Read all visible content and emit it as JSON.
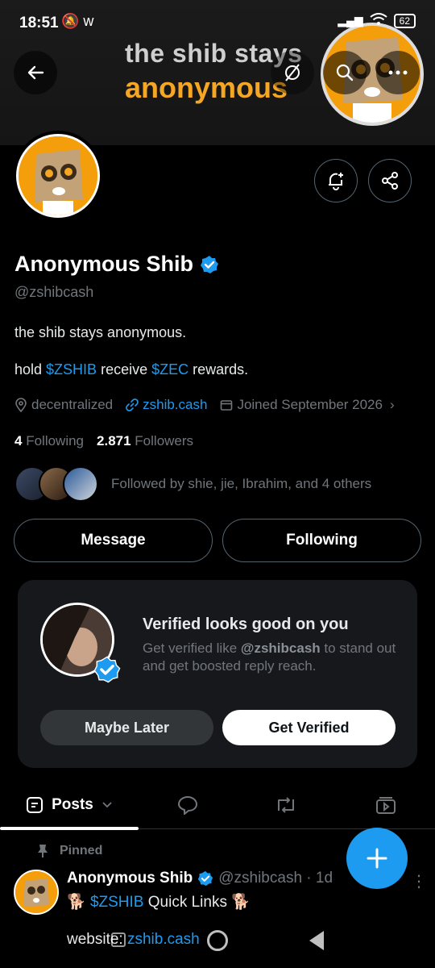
{
  "status_bar": {
    "time": "18:51",
    "notif_icons": "🔕 w",
    "battery": "62"
  },
  "banner": {
    "line1": "the shib stays",
    "line2": "anonymous"
  },
  "profile": {
    "name": "Anonymous Shib",
    "handle": "@zshibcash",
    "bio_line1": "the shib stays anonymous.",
    "bio_line2_prefix": "hold ",
    "bio_line2_tag1": "$ZSHIB",
    "bio_line2_mid": " receive ",
    "bio_line2_tag2": "$ZEC",
    "bio_line2_suffix": " rewards.",
    "location": "decentralized",
    "website": "zshib.cash",
    "joined": "Joined September 2026",
    "following_count": "4",
    "following_label": "Following",
    "followers_count": "2.871",
    "followers_label": "Followers",
    "followed_by": "Followed by shie, jie, Ibrahim, and 4 others"
  },
  "actions": {
    "message": "Message",
    "following": "Following"
  },
  "verify_card": {
    "title": "Verified looks good on you",
    "subtitle_prefix": "Get verified like ",
    "subtitle_handle": "@zshibcash",
    "subtitle_suffix": " to stand out and get boosted reply reach.",
    "maybe_later": "Maybe Later",
    "get_verified": "Get Verified"
  },
  "tabs": {
    "posts": "Posts"
  },
  "pinned_post": {
    "pinned_label": "Pinned",
    "author": "Anonymous Shib",
    "handle_time": "@zshibcash · 1d",
    "line2_prefix": "🐕 ",
    "line2_tag": "$ZSHIB",
    "line2_suffix": " Quick Links 🐕",
    "line3_prefix": "website: ",
    "line3_link": "zshib.cash"
  },
  "colors": {
    "accent": "#1d9bf0",
    "muted": "#71767b",
    "background": "#000000",
    "brand_orange": "#f59e0b"
  }
}
